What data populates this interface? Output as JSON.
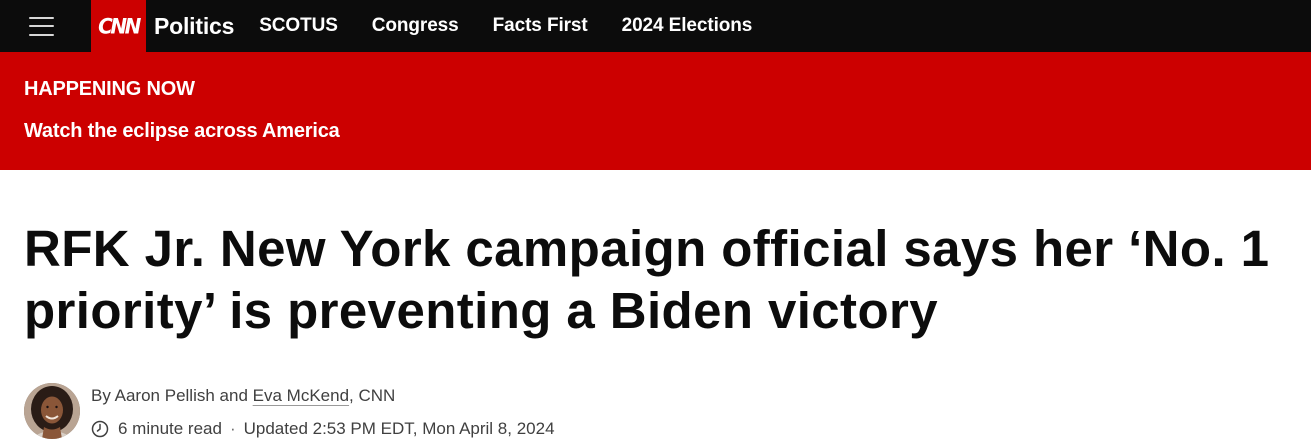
{
  "nav": {
    "logo_text": "CNN",
    "section": "Politics",
    "links": [
      "SCOTUS",
      "Congress",
      "Facts First",
      "2024 Elections"
    ]
  },
  "banner": {
    "label": "HAPPENING NOW",
    "link_text": "Watch the eclipse across America"
  },
  "article": {
    "headline": "RFK Jr. New York campaign official says her ‘No. 1 priority’ is preventing a Biden victory",
    "byline": {
      "prefix": "By",
      "author1": "Aaron Pellish",
      "conjunction": "and",
      "author2": "Eva McKend",
      "outlet": ", CNN"
    },
    "read_time": "6 minute read",
    "updated": "Updated 2:53 PM EDT, Mon April 8, 2024"
  },
  "icons": {
    "menu": "hamburger-menu-icon",
    "clock": "clock-icon"
  },
  "colors": {
    "brand_red": "#cc0000",
    "nav_bg": "#0c0c0c"
  }
}
